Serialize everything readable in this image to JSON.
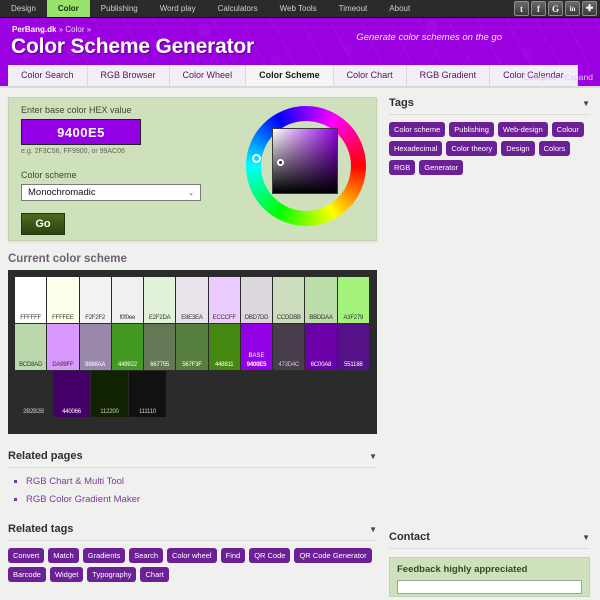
{
  "topnav": {
    "items": [
      {
        "label": "Design",
        "active": false
      },
      {
        "label": "Color",
        "active": true
      },
      {
        "label": "Publishing",
        "active": false
      },
      {
        "label": "Word play",
        "active": false
      },
      {
        "label": "Calculators",
        "active": false
      },
      {
        "label": "Web Tools",
        "active": false
      },
      {
        "label": "Timeout",
        "active": false
      },
      {
        "label": "About",
        "active": false
      }
    ],
    "social": [
      {
        "name": "twitter-icon",
        "glyph": "t"
      },
      {
        "name": "facebook-icon",
        "glyph": "f"
      },
      {
        "name": "google-icon",
        "glyph": "G"
      },
      {
        "name": "linkedin-icon",
        "glyph": "in"
      },
      {
        "name": "share-more-icon",
        "glyph": "✚"
      }
    ]
  },
  "header": {
    "breadcrumb_site": "PerBang.dk",
    "breadcrumb_rest": " » Color »",
    "title": "Color Scheme Generator",
    "tagline": "Generate color schemes on the go",
    "collapse_expand": "Collapse • Expand"
  },
  "tabs": [
    {
      "label": "Color Search",
      "active": false
    },
    {
      "label": "RGB Browser",
      "active": false
    },
    {
      "label": "Color Wheel",
      "active": false
    },
    {
      "label": "Color Scheme",
      "active": true
    },
    {
      "label": "Color Chart",
      "active": false
    },
    {
      "label": "RGB Gradient",
      "active": false
    },
    {
      "label": "Color Calendar",
      "active": false
    }
  ],
  "form": {
    "hex_label": "Enter base color HEX value",
    "hex_value": "9400E5",
    "hex_hint": "e.g. 2F3C56, FF9900, or 99AC06",
    "scheme_label": "Color scheme",
    "scheme_value": "Monochromadic",
    "scheme_options": [
      "Monochromadic"
    ],
    "go_label": "Go",
    "chevron": "⌄"
  },
  "scheme": {
    "heading": "Current color scheme",
    "base_tag": "BASE",
    "rows": [
      [
        {
          "hex": "FFFFFF",
          "text": "#333333"
        },
        {
          "hex": "FFFFEE",
          "text": "#333333"
        },
        {
          "hex": "F2F2F2",
          "text": "#333333"
        },
        {
          "hex": "f0f0ee",
          "text": "#333333"
        },
        {
          "hex": "E2F2DA",
          "text": "#333333"
        },
        {
          "hex": "E8E3EA",
          "text": "#333333"
        },
        {
          "hex": "ECCCFF",
          "text": "#333333"
        },
        {
          "hex": "DBD7DD",
          "text": "#333333"
        },
        {
          "hex": "CCDDBB",
          "text": "#333333"
        },
        {
          "hex": "BBDDAA",
          "text": "#333333"
        },
        {
          "hex": "A3F279",
          "text": "#333333"
        }
      ],
      [
        {
          "hex": "BCD8AD",
          "text": "#333333"
        },
        {
          "hex": "DA99FF",
          "text": "#333333"
        },
        {
          "hex": "9988AA",
          "text": "#ffffff"
        },
        {
          "hex": "449922",
          "text": "#ffffff"
        },
        {
          "hex": "667755",
          "text": "#ffffff"
        },
        {
          "hex": "567F3F",
          "text": "#ffffff"
        },
        {
          "hex": "448811",
          "text": "#ffffff"
        },
        {
          "hex": "9400E5",
          "text": "#ffffff",
          "is_base": true
        },
        {
          "hex": "473D4C",
          "text": "#cccccc"
        },
        {
          "hex": "6C00A8",
          "text": "#ffffff"
        },
        {
          "hex": "551188",
          "text": "#ffffff"
        }
      ],
      [
        {
          "hex": "2B2B2B",
          "text": "#cccccc"
        },
        {
          "hex": "440066",
          "text": "#ffffff"
        },
        {
          "hex": "112200",
          "text": "#cccccc"
        },
        {
          "hex": "111110",
          "text": "#cccccc"
        }
      ]
    ]
  },
  "related_pages": {
    "heading": "Related pages",
    "caret": "▼",
    "items": [
      "RGB Chart & Multi Tool",
      "RGB Color Gradient Maker"
    ]
  },
  "tags_panel": {
    "heading": "Tags",
    "caret": "▼",
    "items": [
      "Color scheme",
      "Publishing",
      "Web-design",
      "Colour",
      "Hexadecimal",
      "Color theory",
      "Design",
      "Colors",
      "RGB",
      "Generator"
    ]
  },
  "related_tags": {
    "heading": "Related tags",
    "caret": "▼",
    "items": [
      "Convert",
      "Match",
      "Gradients",
      "Search",
      "Color wheel",
      "Find",
      "QR Code",
      "QR Code Generator",
      "Barcode",
      "Widget",
      "Typography",
      "Chart"
    ]
  },
  "contact": {
    "heading": "Contact",
    "caret": "▼",
    "feedback_label": "Feedback highly appreciated",
    "input_value": ""
  }
}
